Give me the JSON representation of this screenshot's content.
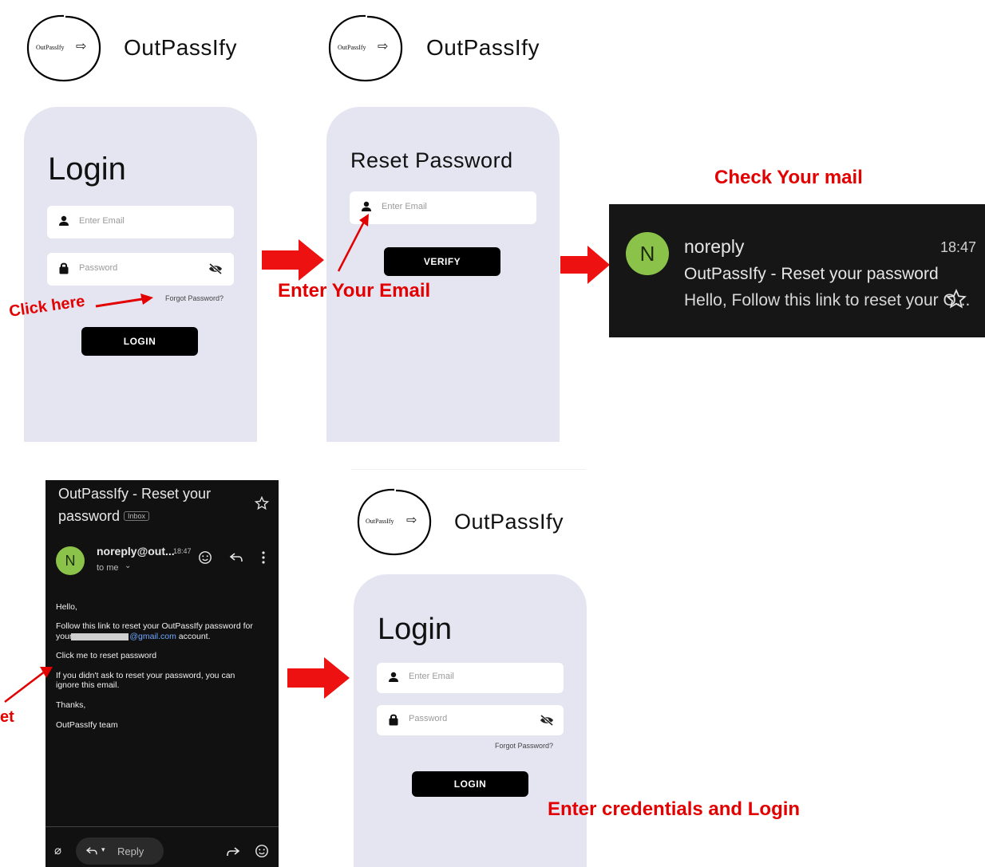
{
  "app": {
    "brand_name": "OutPassIfy",
    "logo_wordmark": "OutPassIfy"
  },
  "screen_login": {
    "title": "Login",
    "email_placeholder": "Enter Email",
    "password_placeholder": "Password",
    "forgot_link": "Forgot Password?",
    "login_button": "LOGIN"
  },
  "screen_reset": {
    "title": "Reset Password",
    "email_placeholder": "Enter Email",
    "verify_button": "VERIFY"
  },
  "notification": {
    "avatar_letter": "N",
    "sender": "noreply",
    "time": "18:47",
    "subject": "OutPassIfy - Reset your password",
    "preview": "Hello, Follow this link to reset your O..."
  },
  "email_view": {
    "subject_line1": "OutPassIfy - Reset your",
    "subject_line2": "password",
    "inbox_badge": "Inbox",
    "avatar_letter": "N",
    "sender": "noreply@out...",
    "time": "18:47",
    "recipient": "to me",
    "greeting": "Hello,",
    "body_line1": "Follow this link to reset your OutPassIfy password for",
    "body_line2_prefix": "your",
    "body_line2_domain": "@gmail.com",
    "body_line2_suffix": "account.",
    "reset_link": "Click me to reset password",
    "ignore_line1": "If you didn't ask to reset your password, you can",
    "ignore_line2": "ignore this email.",
    "thanks": "Thanks,",
    "signature": "OutPassIfy team",
    "reply_label": "Reply"
  },
  "screen_login_final": {
    "title": "Login",
    "email_placeholder": "Enter Email",
    "password_placeholder": "Password",
    "forgot_link": "Forgot Password?",
    "login_button": "LOGIN"
  },
  "annotations": {
    "click_here": "Click here",
    "enter_email": "Enter Your Email",
    "check_mail": "Check Your mail",
    "click_reset_partial": "et",
    "enter_credentials": "Enter credentials and Login"
  },
  "colors": {
    "annotation_red": "#e30000",
    "card_bg": "#e4e5f1",
    "avatar_green": "#8bc34a",
    "link_blue": "#6fa8ff"
  },
  "icons": [
    "person-icon",
    "lock-icon",
    "eye-off-icon",
    "exit-arrow-icon",
    "star-icon",
    "emoji-icon",
    "reply-icon",
    "more-icon",
    "attach-icon",
    "forward-icon",
    "chevron-down-icon"
  ]
}
